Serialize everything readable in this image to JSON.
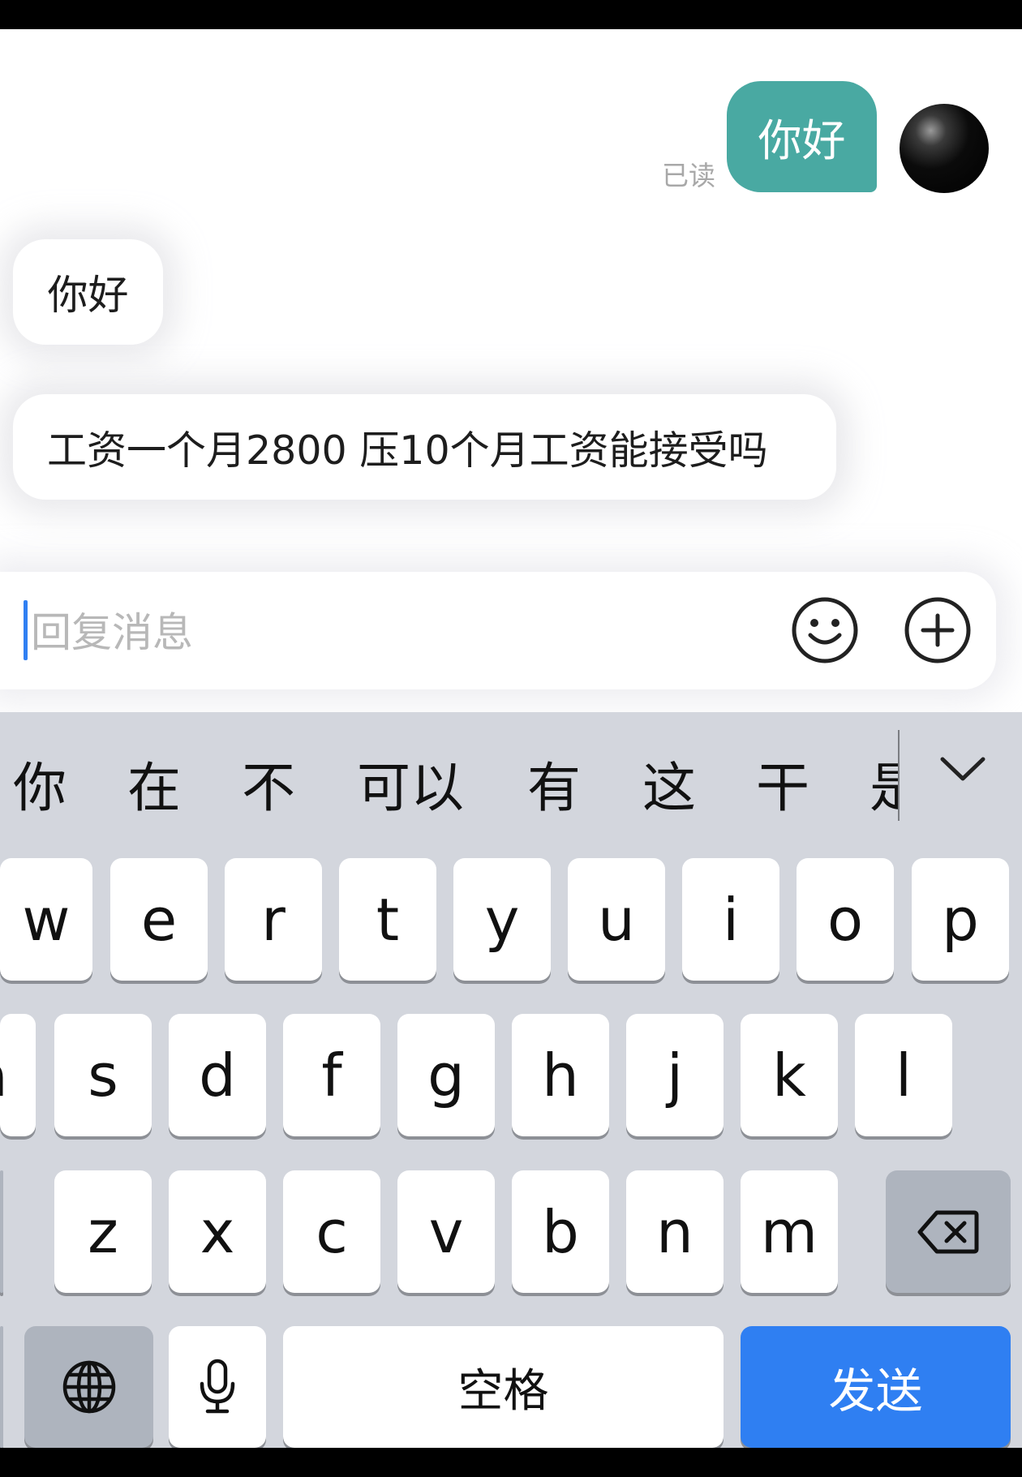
{
  "chat": {
    "outgoing": [
      {
        "text": "你好",
        "status": "已读"
      }
    ],
    "incoming": [
      {
        "text": "你好"
      },
      {
        "text": "工资一个月2800  压10个月工资能接受吗"
      }
    ]
  },
  "input": {
    "placeholder": "回复消息"
  },
  "icons": {
    "emoji": "smiley-icon",
    "more": "plus-circle-icon",
    "globe": "globe-icon",
    "mic": "microphone-icon",
    "delete": "backspace-icon",
    "collapse": "chevron-down-icon"
  },
  "keyboard": {
    "candidates": [
      "你",
      "在",
      "不",
      "可以",
      "有",
      "这",
      "干",
      "是"
    ],
    "row1": [
      "w",
      "e",
      "r",
      "t",
      "y",
      "u",
      "i",
      "o",
      "p"
    ],
    "row2": [
      "a",
      "s",
      "d",
      "f",
      "g",
      "h",
      "j",
      "k",
      "l"
    ],
    "row3": [
      "z",
      "x",
      "c",
      "v",
      "b",
      "n",
      "m"
    ],
    "space_label": "空格",
    "send_label": "发送"
  },
  "colors": {
    "accent": "#2f7ff2",
    "outgoing_bubble": "#49a9a2",
    "keyboard_bg": "#d3d6dd"
  }
}
